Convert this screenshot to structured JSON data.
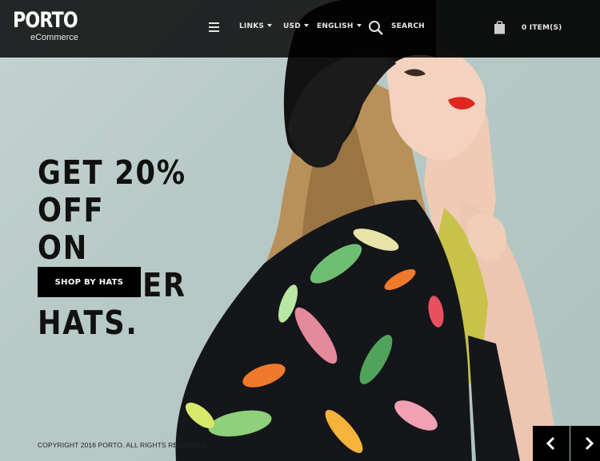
{
  "header": {
    "logo": {
      "brand": "PORTO",
      "tagline": "eCommerce"
    },
    "nav": {
      "links": "LINKS",
      "currency": "USD",
      "language": "ENGLISH",
      "search": "SEARCH"
    },
    "cart": {
      "label": "0 ITEM(S)"
    }
  },
  "hero": {
    "headline_lines": [
      "GET 20% OFF",
      "ON SUMMER",
      "HATS."
    ],
    "cta_label": "SHOP BY HATS"
  },
  "footer": {
    "copyright": "COPYRIGHT 2016 PORTO. ALL RIGHTS RESERVED."
  },
  "icons": {
    "menu": "hamburger-icon",
    "search": "search-icon",
    "cart": "shopping-bag-icon",
    "prev": "chevron-left-icon",
    "next": "chevron-right-icon"
  },
  "colors": {
    "header_bg": "#0d0d0d",
    "hero_bg": "#b7c9c6",
    "button_bg": "#000000",
    "text_dark": "#111111"
  }
}
